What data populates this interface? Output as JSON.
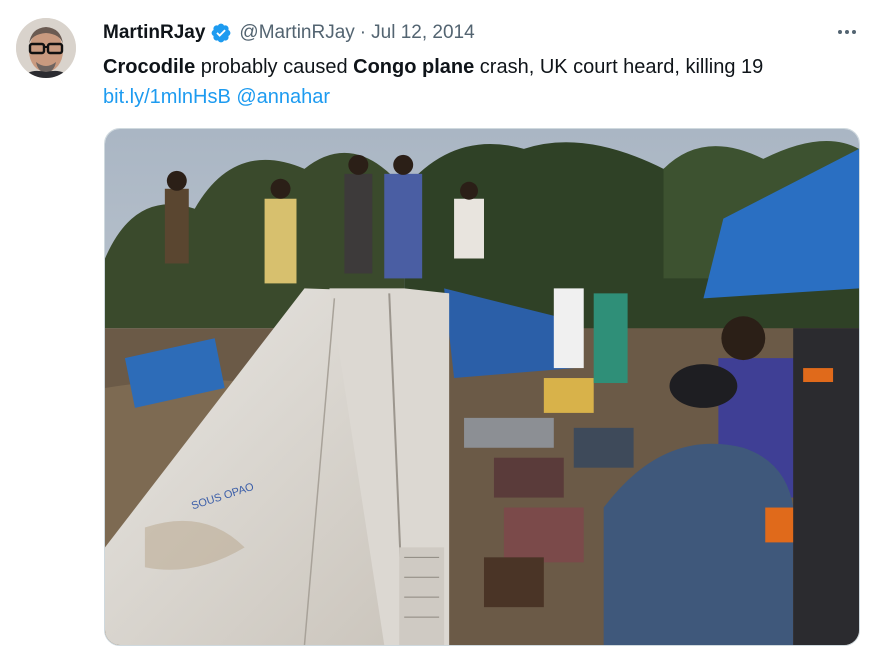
{
  "tweet": {
    "author_name": "MartinRJay",
    "handle": "@MartinRJay",
    "separator": "·",
    "date": "Jul 12, 2014",
    "text_parts": [
      {
        "text": "Crocodile",
        "bold": true
      },
      {
        "text": " probably caused ",
        "bold": false
      },
      {
        "text": "Congo plane",
        "bold": true
      },
      {
        "text": " crash, UK court heard, killing 19",
        "bold": false
      }
    ],
    "link_url": "bit.ly/1mlnHsB",
    "mention": "@annahar",
    "verified": true,
    "more_icon": "more-horizontal-icon",
    "verified_icon": "verified-badge-icon"
  },
  "colors": {
    "link": "#1d9bf0",
    "verified": "#1d9bf0",
    "secondary_text": "#536471",
    "primary_text": "#0f1419"
  },
  "media": {
    "type": "photo",
    "wing_text": "SOUS OPAO"
  }
}
